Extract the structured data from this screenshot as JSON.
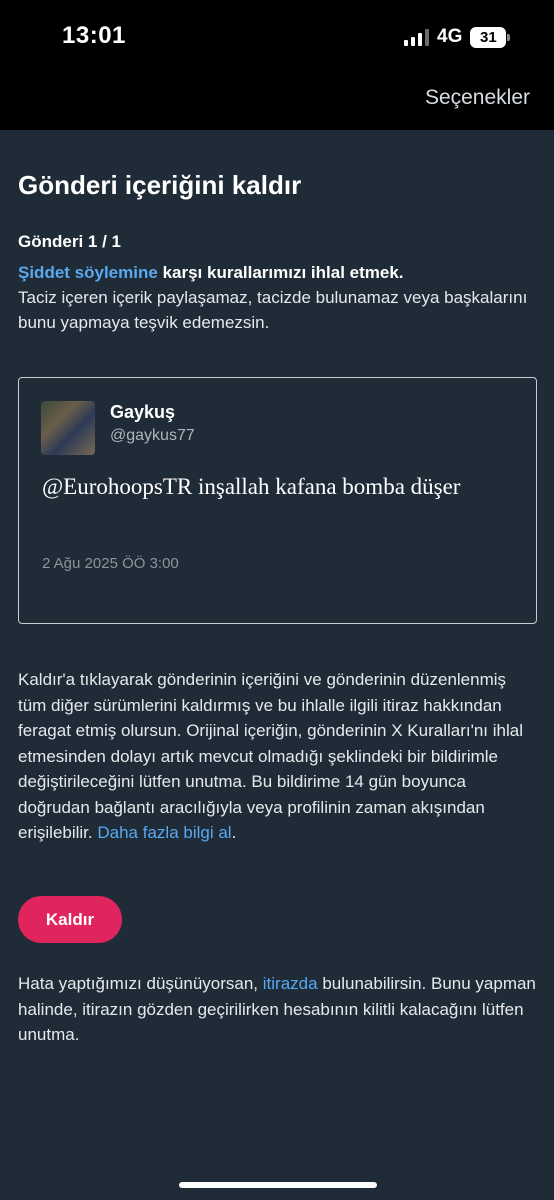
{
  "status_bar": {
    "time": "13:01",
    "network": "4G",
    "battery": "31",
    "icons": [
      "signal-icon",
      "battery-icon"
    ]
  },
  "nav": {
    "options_label": "Seçenekler"
  },
  "page": {
    "title": "Gönderi içeriğini kaldır",
    "post_counter": "Gönderi 1 / 1",
    "violation_link": "Şiddet söylemine",
    "violation_bold": "karşı kurallarımızı ihlal etmek.",
    "violation_desc": "Taciz içeren içerik paylaşamaz, tacizde bulunamaz veya başkalarını bunu yapmaya teşvik edemezsin."
  },
  "tweet": {
    "name": "Gaykuş",
    "handle": "@gaykus77",
    "text": "@EurohoopsTR inşallah kafana bomba düşer",
    "date": "2 Ağu 2025 ÖÖ 3:00"
  },
  "info": {
    "text": "Kaldır'a tıklayarak gönderinin içeriğini ve gönderinin düzenlenmiş tüm diğer sürümlerini kaldırmış ve bu ihlalle ilgili itiraz hakkından feragat etmiş olursun. Orijinal içeriğin, gönderinin X Kuralları'nı ihlal etmesinden dolayı artık mevcut olmadığı şeklindeki bir bildirimle değiştirileceğini lütfen unutma. Bu bildirime 14 gün boyunca doğrudan bağlantı aracılığıyla veya profilinin zaman akışından erişilebilir.",
    "link": "Daha fazla bilgi al",
    "link_suffix": "."
  },
  "actions": {
    "remove_label": "Kaldır"
  },
  "appeal": {
    "prefix": "Hata yaptığımızı düşünüyorsan,",
    "link": "itirazda",
    "suffix": "bulunabilirsin. Bunu yapman halinde, itirazın gözden geçirilirken hesabının kilitli kalacağını lütfen unutma."
  },
  "colors": {
    "background": "#1f2b36",
    "link": "#5aa8f0",
    "remove_button": "#e0245e"
  }
}
